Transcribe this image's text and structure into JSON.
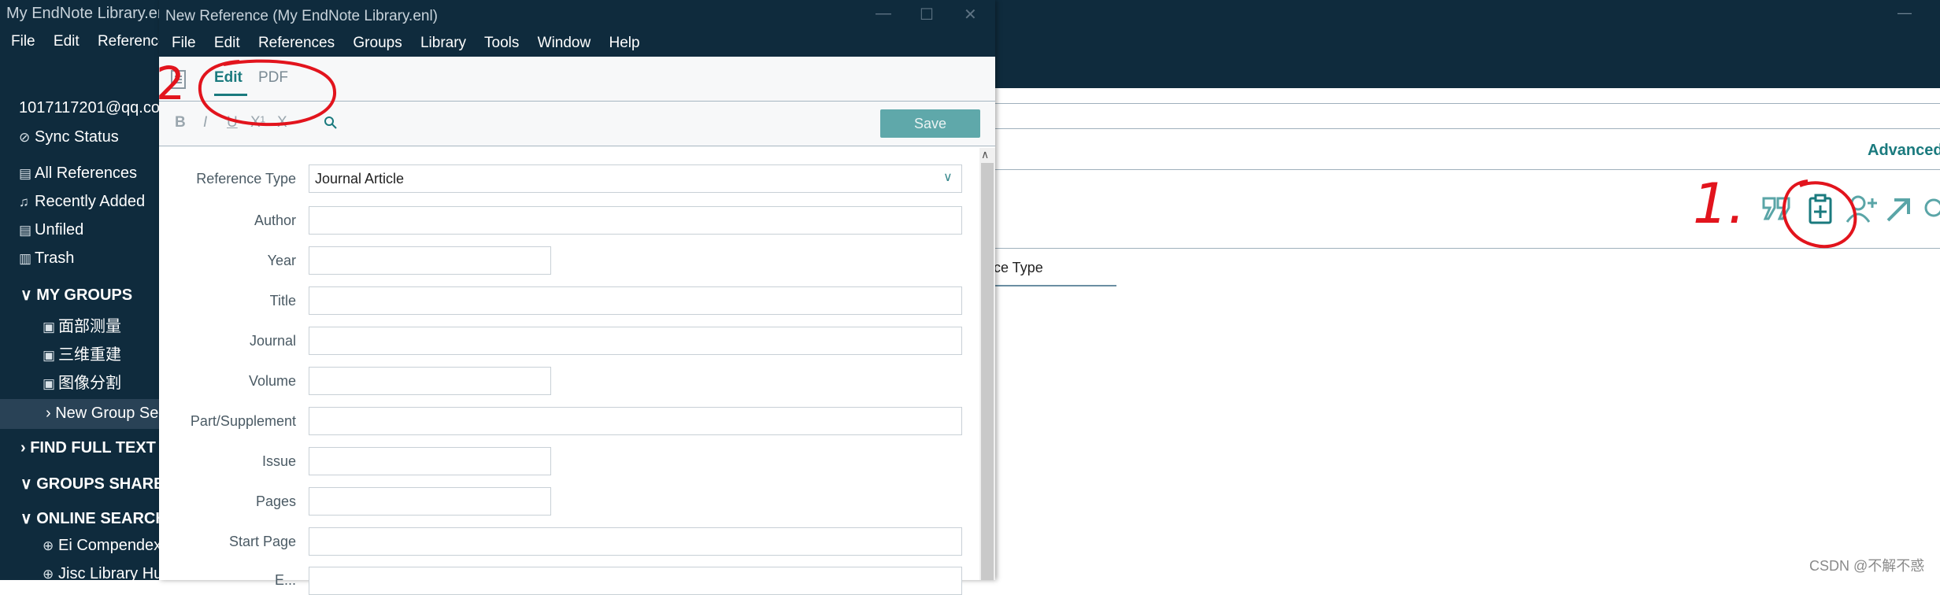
{
  "main_window": {
    "title": "My EndNote Library.enl",
    "menu": [
      "File",
      "Edit",
      "References"
    ],
    "account": "1017117201@qq.co",
    "sync_status": "Sync Status",
    "sidebar": {
      "items": [
        {
          "label": "All References",
          "icon": "document-icon"
        },
        {
          "label": "Recently Added",
          "icon": "bell-icon"
        },
        {
          "label": "Unfiled",
          "icon": "document-icon"
        },
        {
          "label": "Trash",
          "icon": "trash-icon"
        }
      ],
      "my_groups_header": "MY GROUPS",
      "groups": [
        "面部测量",
        "三维重建",
        "图像分割"
      ],
      "new_group_set": "New Group Se",
      "find_full_text": "FIND FULL TEXT",
      "groups_shared": "GROUPS SHARE",
      "online_search": "ONLINE SEARCH",
      "online_items": [
        "Ei Compendex",
        "Jisc Library Hu"
      ]
    },
    "advanced_search": "Advanced",
    "column_header": "ce Type"
  },
  "dialog": {
    "title": "New Reference (My EndNote Library.enl)",
    "menu": [
      "File",
      "Edit",
      "References",
      "Groups",
      "Library",
      "Tools",
      "Window",
      "Help"
    ],
    "tabs": {
      "edit": "Edit",
      "pdf": "PDF"
    },
    "format_buttons": {
      "bold": "B",
      "italic": "I",
      "underline": "U",
      "superscript": "X¹",
      "subscript": "X"
    },
    "save_label": "Save",
    "fields": {
      "reference_type": {
        "label": "Reference Type",
        "value": "Journal Article"
      },
      "author": "Author",
      "year": "Year",
      "title": "Title",
      "journal": "Journal",
      "volume": "Volume",
      "part_supplement": "Part/Supplement",
      "issue": "Issue",
      "pages": "Pages",
      "start_page": "Start Page",
      "epub": "E..."
    }
  },
  "annotations": {
    "step_one": "1.",
    "step_two": "2"
  },
  "watermark": "CSDN @不解不惑",
  "colors": {
    "dark_navy": "#0f2b3d",
    "teal": "#1a7a7e",
    "save_button": "#5fa8aa",
    "annotation_red": "#e2141d"
  }
}
